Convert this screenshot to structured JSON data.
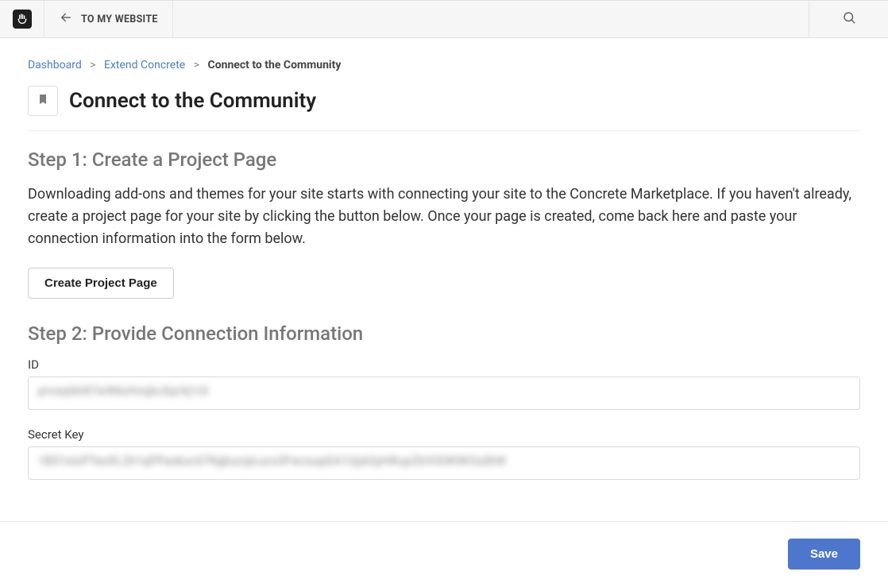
{
  "topbar": {
    "back_label": "TO MY WEBSITE"
  },
  "breadcrumb": {
    "items": [
      {
        "label": "Dashboard",
        "link": true
      },
      {
        "label": "Extend Concrete",
        "link": true
      },
      {
        "label": "Connect to the Community",
        "link": false
      }
    ]
  },
  "page": {
    "title": "Connect to the Community"
  },
  "step1": {
    "heading": "Step 1: Create a Project Page",
    "body": "Downloading add-ons and themes for your site starts with connecting your site to the Concrete Marketplace. If you haven't already, create a project page for your site by clicking the button below. Once your page is created, come back here and paste your connection information into the form below.",
    "button_label": "Create Project Page"
  },
  "step2": {
    "heading": "Step 2: Provide Connection Information",
    "id_label": "ID",
    "id_value": "prvwpbh87wWkzHvqbcXprXj1r0",
    "secret_label": "Secret Key",
    "secret_value": "1B01sioPTeoXL2h1qPPaskuc67NgkucipLucs3FwcsupDA1Ujat2pHKupZbVtSWIWOzdhW"
  },
  "footer": {
    "save_label": "Save"
  },
  "colors": {
    "primary": "#4d77cc",
    "link": "#4b7fbf"
  }
}
